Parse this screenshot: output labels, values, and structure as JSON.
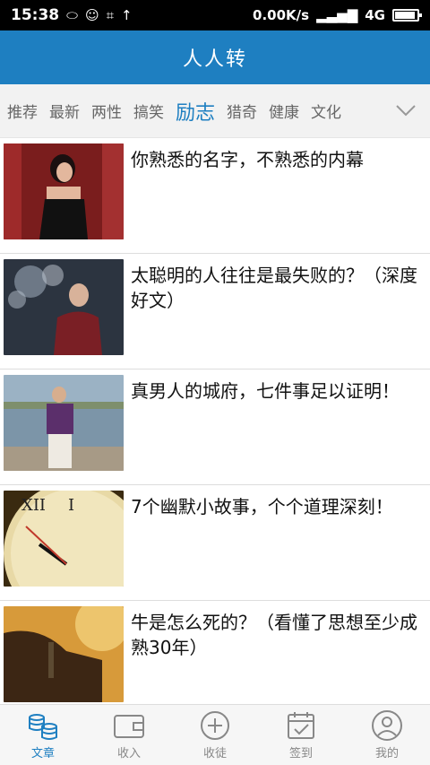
{
  "status_bar": {
    "time": "15:38",
    "net_speed": "0.00K/s",
    "network": "4G",
    "battery_level": 0.9
  },
  "app": {
    "title": "人人转"
  },
  "tabs": {
    "items": [
      "推荐",
      "最新",
      "两性",
      "搞笑",
      "励志",
      "猎奇",
      "健康",
      "文化"
    ],
    "active": "励志"
  },
  "articles": [
    {
      "title": "你熟悉的名字，不熟悉的内幕"
    },
    {
      "title": "太聪明的人往往是最失败的？（深度好文）"
    },
    {
      "title": "真男人的城府，七件事足以证明！"
    },
    {
      "title": "7个幽默小故事，个个道理深刻！"
    },
    {
      "title": "牛是怎么死的？（看懂了思想至少成熟30年）"
    }
  ],
  "bottom_nav": {
    "items": [
      {
        "label": "文章",
        "icon": "coins-icon"
      },
      {
        "label": "收入",
        "icon": "wallet-icon"
      },
      {
        "label": "收徒",
        "icon": "plus-circle-icon"
      },
      {
        "label": "签到",
        "icon": "calendar-check-icon"
      },
      {
        "label": "我的",
        "icon": "user-icon"
      }
    ],
    "active": "文章"
  },
  "colors": {
    "primary": "#1e7fc1"
  }
}
